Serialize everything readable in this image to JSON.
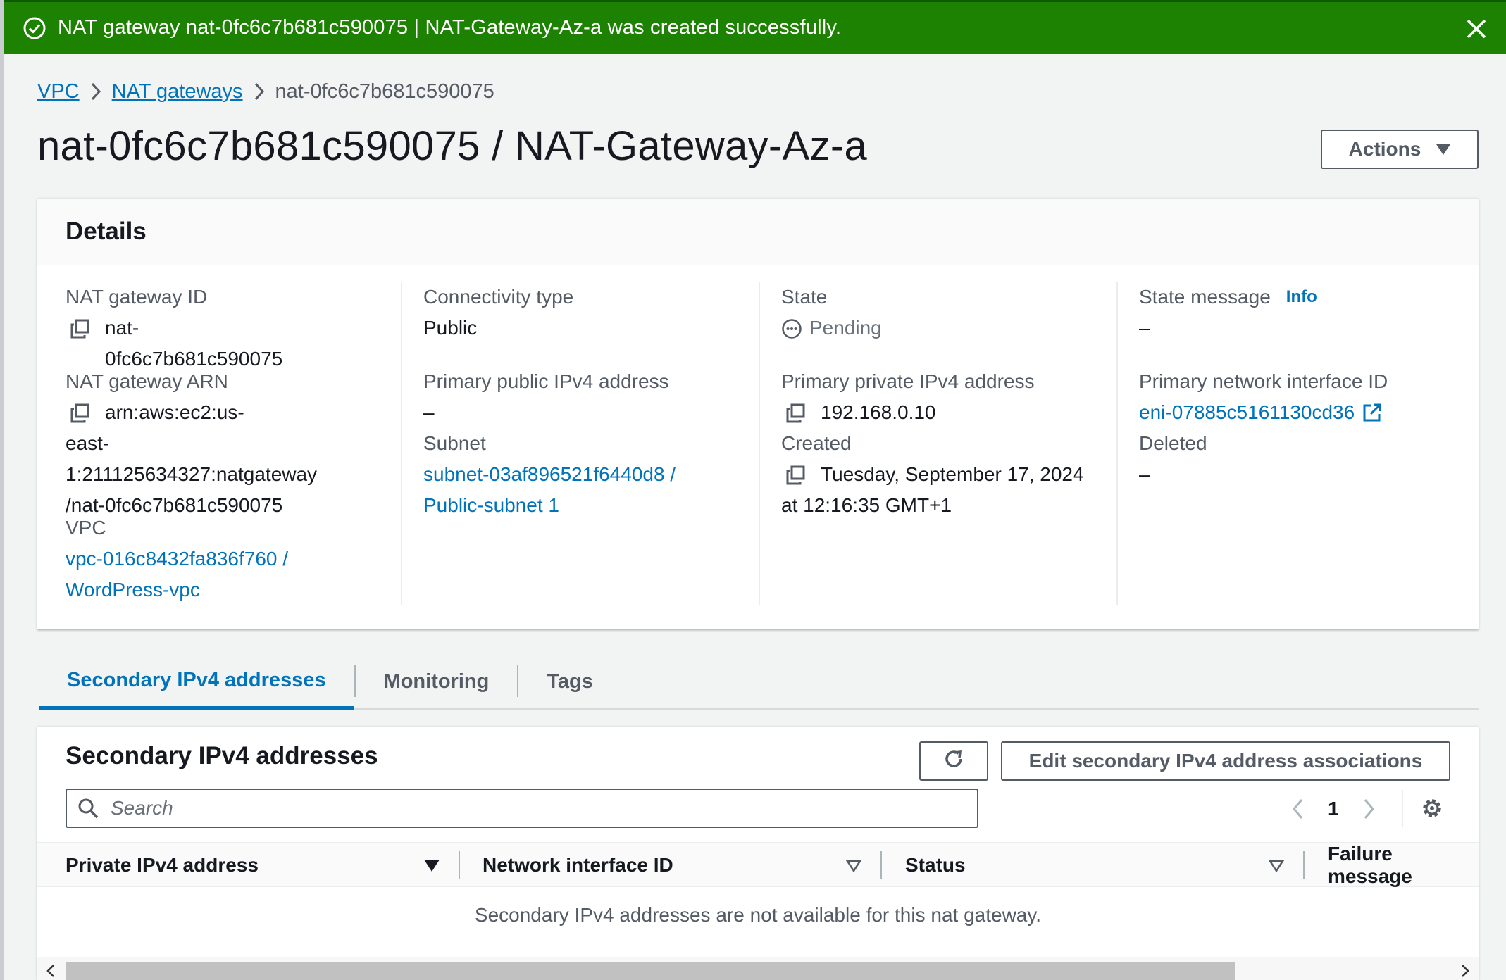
{
  "flash": {
    "message": "NAT gateway nat-0fc6c7b681c590075 | NAT-Gateway-Az-a was created successfully."
  },
  "breadcrumb": {
    "items": [
      "VPC",
      "NAT gateways"
    ],
    "current": "nat-0fc6c7b681c590075"
  },
  "page_title": "nat-0fc6c7b681c590075 / NAT-Gateway-Az-a",
  "actions_label": "Actions",
  "details": {
    "title": "Details",
    "nat_gateway_id": {
      "label": "NAT gateway ID",
      "value": "nat-0fc6c7b681c590075"
    },
    "nat_gateway_arn": {
      "label": "NAT gateway ARN",
      "line1": "arn:aws:ec2:us-",
      "line2": "east-1:211125634327:natgateway",
      "line3": "/nat-0fc6c7b681c590075"
    },
    "vpc": {
      "label": "VPC",
      "line1": "vpc-016c8432fa836f760 /",
      "line2": "WordPress-vpc"
    },
    "connectivity_type": {
      "label": "Connectivity type",
      "value": "Public"
    },
    "primary_public_ipv4": {
      "label": "Primary public IPv4 address",
      "value": "–"
    },
    "subnet": {
      "label": "Subnet",
      "line1": "subnet-03af896521f6440d8 /",
      "line2": "Public-subnet 1"
    },
    "state": {
      "label": "State",
      "value": "Pending"
    },
    "primary_private_ipv4": {
      "label": "Primary private IPv4 address",
      "value": "192.168.0.10"
    },
    "created": {
      "label": "Created",
      "line1": "Tuesday, September 17, 2024",
      "line2": "at 12:16:35 GMT+1"
    },
    "state_message": {
      "label": "State message",
      "info": "Info",
      "value": "–"
    },
    "primary_network_interface": {
      "label": "Primary network interface ID",
      "value": "eni-07885c5161130cd36"
    },
    "deleted": {
      "label": "Deleted",
      "value": "–"
    }
  },
  "tabs": [
    {
      "label": "Secondary IPv4 addresses",
      "active": true
    },
    {
      "label": "Monitoring",
      "active": false
    },
    {
      "label": "Tags",
      "active": false
    }
  ],
  "secondary": {
    "title": "Secondary IPv4 addresses",
    "edit_label": "Edit secondary IPv4 address associations",
    "search_placeholder": "Search",
    "page": "1",
    "columns": [
      "Private IPv4 address",
      "Network interface ID",
      "Status",
      "Failure message"
    ],
    "empty_message": "Secondary IPv4 addresses are not available for this nat gateway."
  },
  "colors": {
    "success": "#1d8102",
    "link": "#0073bb",
    "text": "#16191f",
    "label": "#545b64"
  },
  "icons": [
    "check-circle-icon",
    "close-icon",
    "chevron-right-icon",
    "copy-icon",
    "pending-icon",
    "external-link-icon",
    "refresh-icon",
    "search-icon",
    "chevron-left-icon",
    "gear-icon",
    "sort-icon"
  ]
}
